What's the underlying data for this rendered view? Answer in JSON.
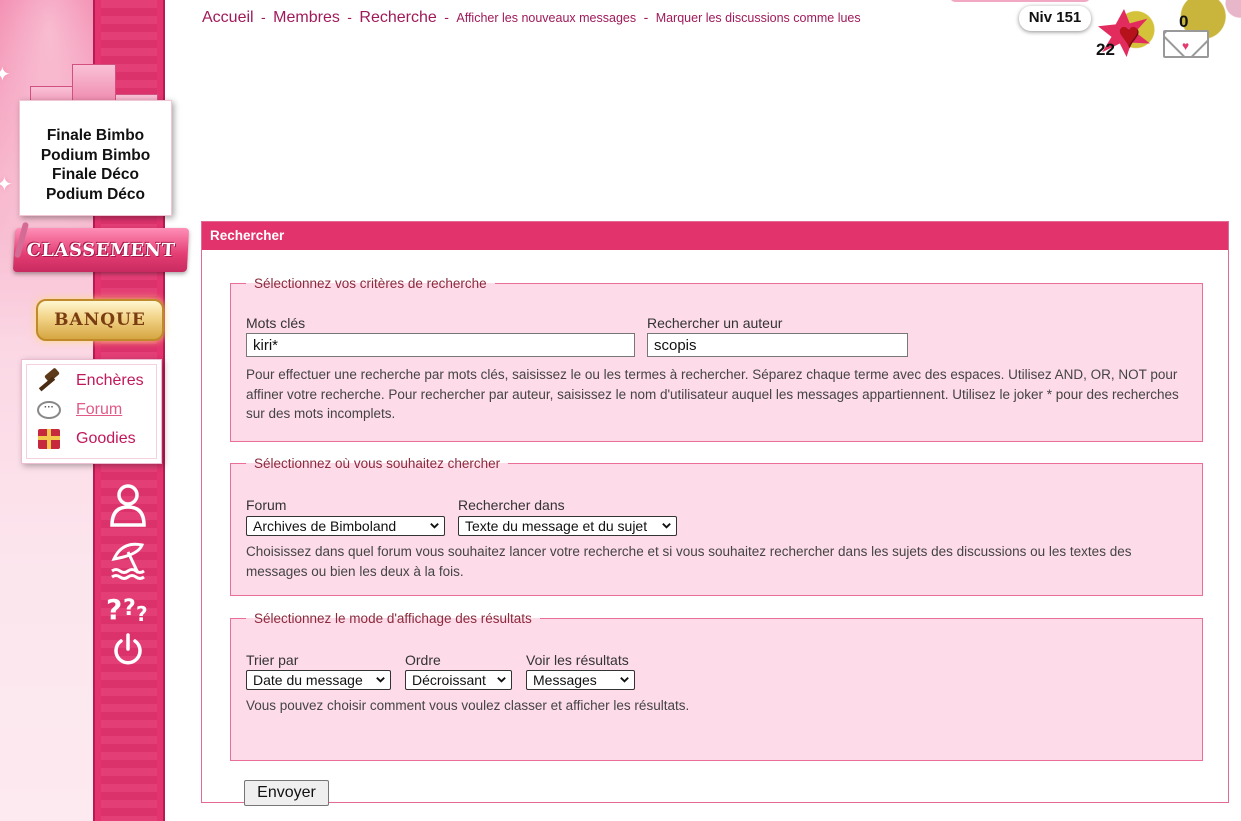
{
  "sidebar": {
    "finale_links": [
      "Finale Bimbo",
      "Podium Bimbo",
      "Finale Déco",
      "Podium Déco"
    ],
    "classement_label": "CLASSEMENT",
    "banque_label": "BANQUE",
    "menu": [
      {
        "label": "Enchères",
        "icon": "gavel-icon"
      },
      {
        "label": "Forum",
        "icon": "chat-bubble-icon",
        "active": true
      },
      {
        "label": "Goodies",
        "icon": "gift-icon"
      }
    ]
  },
  "nav": {
    "accueil": "Accueil",
    "membres": "Membres",
    "recherche": "Recherche",
    "nouveaux": "Afficher les nouveaux messages",
    "marquer": "Marquer les discussions comme lues",
    "separator": "-"
  },
  "hud": {
    "niveau": "Niv 151",
    "hearts": "22",
    "messages": "0"
  },
  "search": {
    "title": "Rechercher",
    "criteria": {
      "legend": "Sélectionnez vos critères de recherche",
      "keywords_label": "Mots clés",
      "keywords_value": "kiri*",
      "author_label": "Rechercher un auteur",
      "author_value": "scopis",
      "help": "Pour effectuer une recherche par mots clés, saisissez le ou les termes à rechercher. Séparez chaque terme avec des espaces. Utilisez AND, OR, NOT pour affiner votre recherche. Pour rechercher par auteur, saisissez le nom d'utilisateur auquel les messages appartiennent. Utilisez le joker * pour des recherches sur des mots incomplets."
    },
    "where": {
      "legend": "Sélectionnez où vous souhaitez chercher",
      "forum_label": "Forum",
      "forum_value": "Archives de Bimboland",
      "searchin_label": "Rechercher dans",
      "searchin_value": "Texte du message et du sujet",
      "help": "Choisissez dans quel forum vous souhaitez lancer votre recherche et si vous souhaitez rechercher dans les sujets des discussions ou les textes des messages ou bien les deux à la fois."
    },
    "display": {
      "legend": "Sélectionnez le mode d'affichage des résultats",
      "sort_label": "Trier par",
      "sort_value": "Date du message",
      "order_label": "Ordre",
      "order_value": "Décroissant",
      "view_label": "Voir les résultats",
      "view_value": "Messages",
      "help": "Vous pouvez choisir comment vous voulez classer et afficher les résultats."
    },
    "submit_label": "Envoyer"
  },
  "colors": {
    "accent": "#e2336c",
    "fieldset_bg": "#fddbe9",
    "link": "#a01a5a"
  }
}
